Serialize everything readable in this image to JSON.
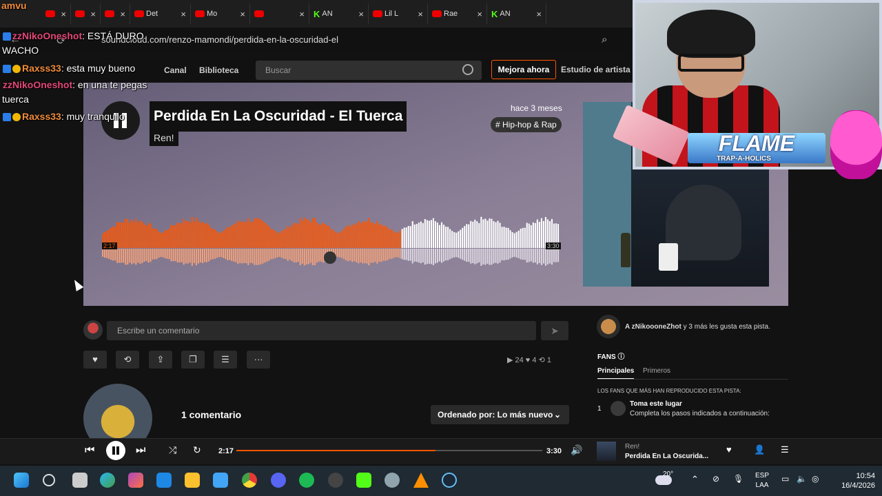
{
  "browser": {
    "tabs": [
      {
        "icon": "youtube-icon",
        "label": ""
      },
      {
        "icon": "youtube-icon",
        "label": ""
      },
      {
        "icon": "youtube-icon",
        "label": ""
      },
      {
        "icon": "youtube-icon",
        "label": "Det"
      },
      {
        "icon": "youtube-icon",
        "label": "Mo"
      },
      {
        "icon": "youtube-icon",
        "label": ""
      },
      {
        "icon": "kick-icon",
        "label": "AN"
      },
      {
        "icon": "youtube-icon",
        "label": "Lil L"
      },
      {
        "icon": "youtube-icon",
        "label": "Rae"
      },
      {
        "icon": "kick-icon",
        "label": "AN"
      }
    ],
    "url": "soundcloud.com/renzo-mamondi/perdida-en-la-oscuridad-el"
  },
  "soundcloud_nav": {
    "links": [
      "Canal",
      "Biblioteca"
    ],
    "search_placeholder": "Buscar",
    "upgrade": "Mejora ahora",
    "studio": "Estudio de artista"
  },
  "track": {
    "title": "Perdida En La Oscuridad - El Tuerca",
    "artist": "Ren!",
    "posted": "hace 3 meses",
    "tag": "# Hip-hop & Rap",
    "time_current": "2:17",
    "time_total": "3:30",
    "progress": 0.652
  },
  "comment_box": {
    "placeholder": "Escribe un comentario"
  },
  "actions": {
    "stats": "▶ 24   ♥ 4   ⟲ 1"
  },
  "comments": {
    "count": "1 comentario",
    "sort": "Ordenado por: Lo más nuevo"
  },
  "sidebar": {
    "likes_user": "A zNikoooneZhot",
    "likes_rest": " y 3 más les gusta esta pista.",
    "fans_title": "FANS",
    "tab_top": "Principales",
    "tab_first": "Primeros",
    "fans_heading": "LOS FANS QUE MÁS HAN REPRODUCIDO ESTA PISTA:",
    "rank": "1",
    "rank_title": "Toma este lugar",
    "rank_sub": "Completa los pasos indicados a continuación:"
  },
  "player": {
    "current": "2:17",
    "total": "3:30",
    "progress": 0.652,
    "artist": "Ren!",
    "title": "Perdida En La Oscurida..."
  },
  "taskbar": {
    "temp": "20°",
    "lang1": "ESP",
    "lang2": "LAA",
    "time": "10:54",
    "date": "16/4/2026"
  },
  "chat": [
    {
      "user": "amvu",
      "msg": ""
    },
    {
      "user": "zzNikoOneshot",
      "msg": ": ESTÁ DURO"
    },
    {
      "user": "",
      "msg": "WACHO"
    },
    {
      "user": "Raxss33",
      "msg": ": esta muy bueno"
    },
    {
      "user": "zzNikoOneshot",
      "msg": ": en una te pegas"
    },
    {
      "user": "",
      "msg": "tuerca"
    },
    {
      "user": "Raxss33",
      "msg": ": muy tranquilo"
    }
  ],
  "overlay": {
    "flame": "FLAME",
    "flame_sub": "TRAP-A-HOLICS"
  },
  "colors": {
    "accent": "#ff5500",
    "background": "#121212"
  }
}
